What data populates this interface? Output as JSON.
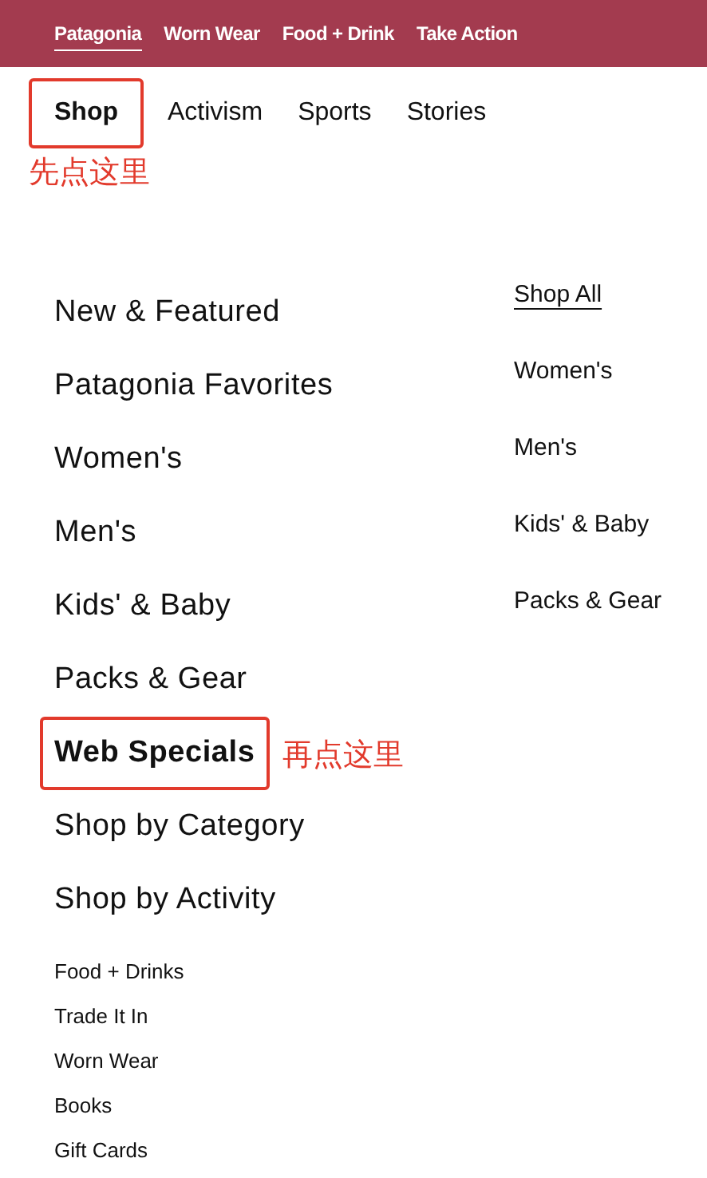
{
  "brand_tabs": [
    {
      "label": "Patagonia",
      "selected": true
    },
    {
      "label": "Worn Wear",
      "selected": false
    },
    {
      "label": "Food + Drink",
      "selected": false
    },
    {
      "label": "Take Action",
      "selected": false
    }
  ],
  "nav_tabs": [
    {
      "label": "Shop",
      "selected": true,
      "annotation": "先点这里"
    },
    {
      "label": "Activism",
      "selected": false
    },
    {
      "label": "Sports",
      "selected": false
    },
    {
      "label": "Stories",
      "selected": false
    }
  ],
  "main_menu": [
    {
      "label": "New & Featured",
      "selected": false
    },
    {
      "label": "Patagonia Favorites",
      "selected": false
    },
    {
      "label": "Women's",
      "selected": false
    },
    {
      "label": "Men's",
      "selected": false
    },
    {
      "label": "Kids' & Baby",
      "selected": false
    },
    {
      "label": "Packs & Gear",
      "selected": false
    },
    {
      "label": "Web Specials",
      "selected": true,
      "annotation": "再点这里"
    },
    {
      "label": "Shop by Category",
      "selected": false
    },
    {
      "label": "Shop by Activity",
      "selected": false
    }
  ],
  "side_links": [
    {
      "label": "Shop All",
      "underlined": true
    },
    {
      "label": "Women's",
      "underlined": false
    },
    {
      "label": "Men's",
      "underlined": false
    },
    {
      "label": "Kids' & Baby",
      "underlined": false
    },
    {
      "label": "Packs & Gear",
      "underlined": false
    }
  ],
  "footer_links": [
    "Food + Drinks",
    "Trade It In",
    "Worn Wear",
    "Books",
    "Gift Cards"
  ]
}
